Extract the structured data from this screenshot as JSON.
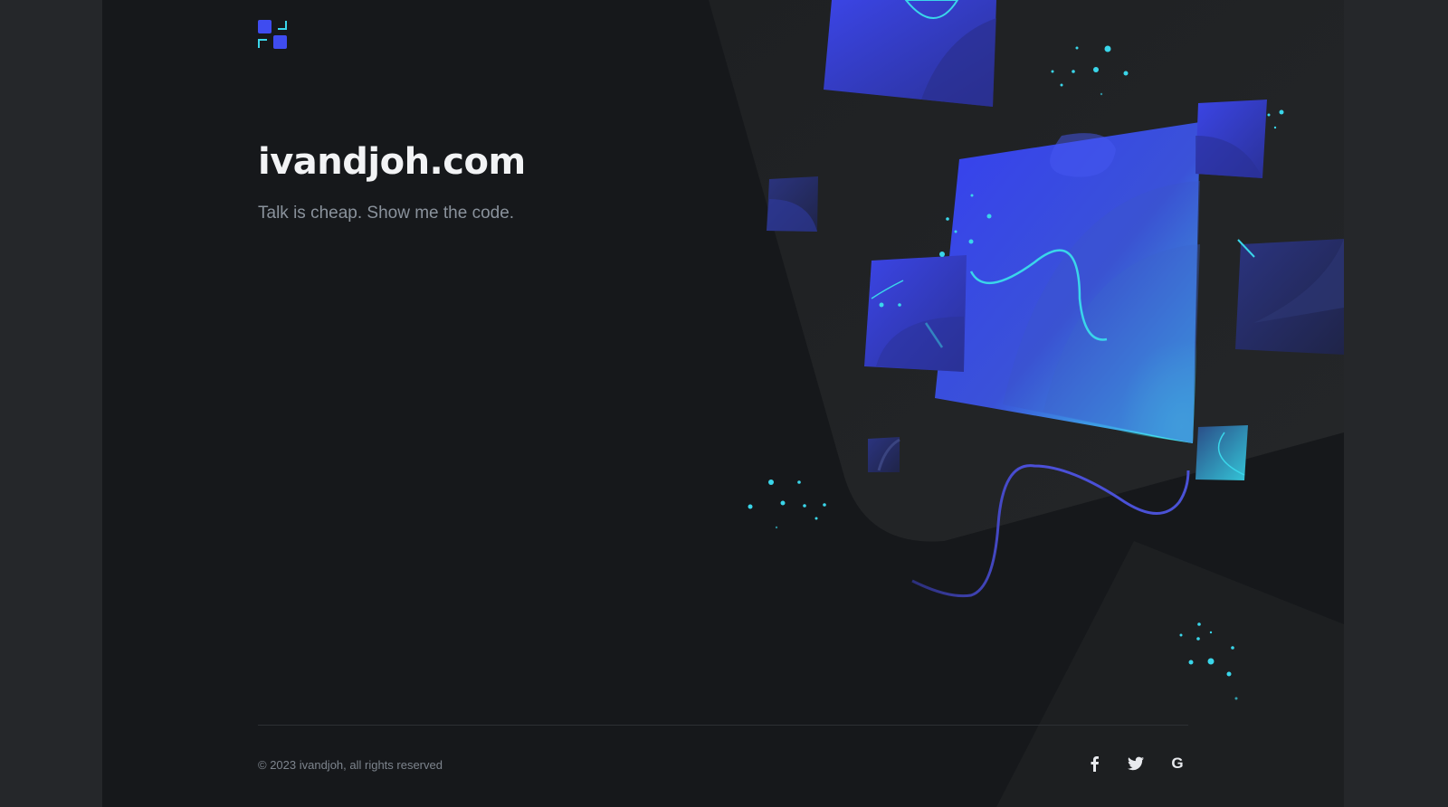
{
  "site": {
    "title": "ivandjoh.com",
    "tagline": "Talk is cheap. Show me the code."
  },
  "logo": {
    "icon": "grid-squares-logo-icon"
  },
  "footer": {
    "copyright": "© 2023 ivandjoh, all rights reserved",
    "social": [
      {
        "name": "facebook",
        "icon": "facebook-icon"
      },
      {
        "name": "twitter",
        "icon": "twitter-icon"
      },
      {
        "name": "google",
        "icon": "google-icon",
        "glyph": "G"
      }
    ]
  },
  "colors": {
    "background": "#16181b",
    "outer": "#25272a",
    "accent_blue": "#3f4cf0",
    "accent_cyan": "#3ce6f0"
  }
}
